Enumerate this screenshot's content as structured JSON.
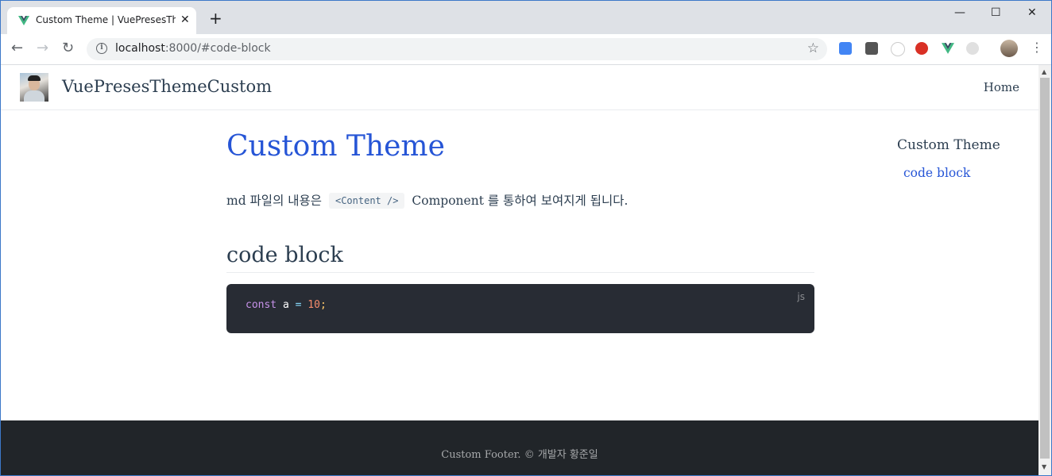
{
  "browser": {
    "tab_title": "Custom Theme | VuePresesThemeCustom",
    "url_host": "localhost",
    "url_path": ":8000/#code-block",
    "window_controls": {
      "minimize": "—",
      "maximize": "☐",
      "close": "✕"
    },
    "extensions": [
      "google-translate-icon",
      "instapaper-icon",
      "react-devtools-icon",
      "yab-icon",
      "vue-devtools-icon",
      "globe-icon"
    ],
    "colors": {
      "tab_strip": "#dee1e6",
      "vue_green": "#41b883"
    }
  },
  "site": {
    "title": "VuePresesThemeCustom",
    "nav": {
      "home": "Home"
    }
  },
  "page": {
    "h1": "Custom Theme",
    "paragraph_before": "md 파일의 내용은",
    "inline_code": "<Content />",
    "paragraph_after": "Component 를 통하여 보여지게 됩니다.",
    "h2": "code block",
    "code": {
      "lang": "js",
      "tokens": {
        "kw": "const",
        "ident": "a",
        "op": "=",
        "num": "10",
        "punct": ";"
      }
    }
  },
  "toc": {
    "title": "Custom Theme",
    "items": [
      "code block"
    ]
  },
  "footer": {
    "text": "Custom Footer. © 개발자 황준일"
  },
  "colors": {
    "accent": "#2655d6",
    "text": "#2c3e50",
    "code_bg": "#282c34",
    "footer_bg": "#212529"
  }
}
